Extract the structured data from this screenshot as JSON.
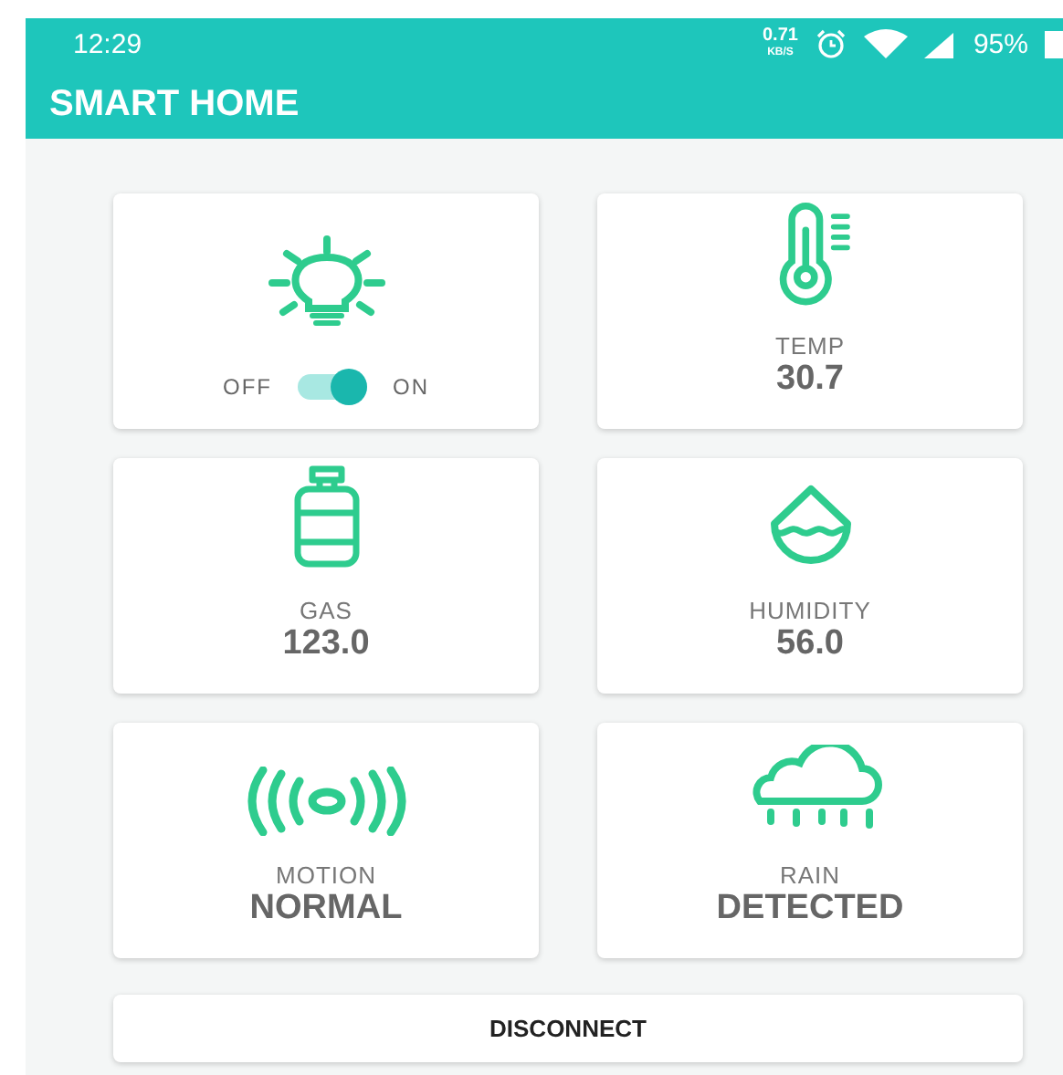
{
  "status_bar": {
    "time": "12:29",
    "speed": "0.71",
    "speed_unit": "KB/S",
    "battery": "95%"
  },
  "app_bar": {
    "title": "SMART HOME"
  },
  "rows": [
    {
      "cards": [
        {
          "kind": "switch",
          "off_label": "OFF",
          "on_label": "ON",
          "on": true
        },
        {
          "kind": "sensor",
          "label": "TEMP",
          "value": "30.7"
        }
      ]
    },
    {
      "cards": [
        {
          "kind": "sensor",
          "label": "GAS",
          "value": "123.0"
        },
        {
          "kind": "sensor",
          "label": "HUMIDITY",
          "value": "56.0"
        }
      ]
    },
    {
      "cards": [
        {
          "kind": "sensor",
          "label": "MOTION",
          "value": "NORMAL"
        },
        {
          "kind": "sensor",
          "label": "RAIN",
          "value": "DETECTED"
        }
      ]
    }
  ],
  "button": {
    "label": "DISCONNECT"
  }
}
